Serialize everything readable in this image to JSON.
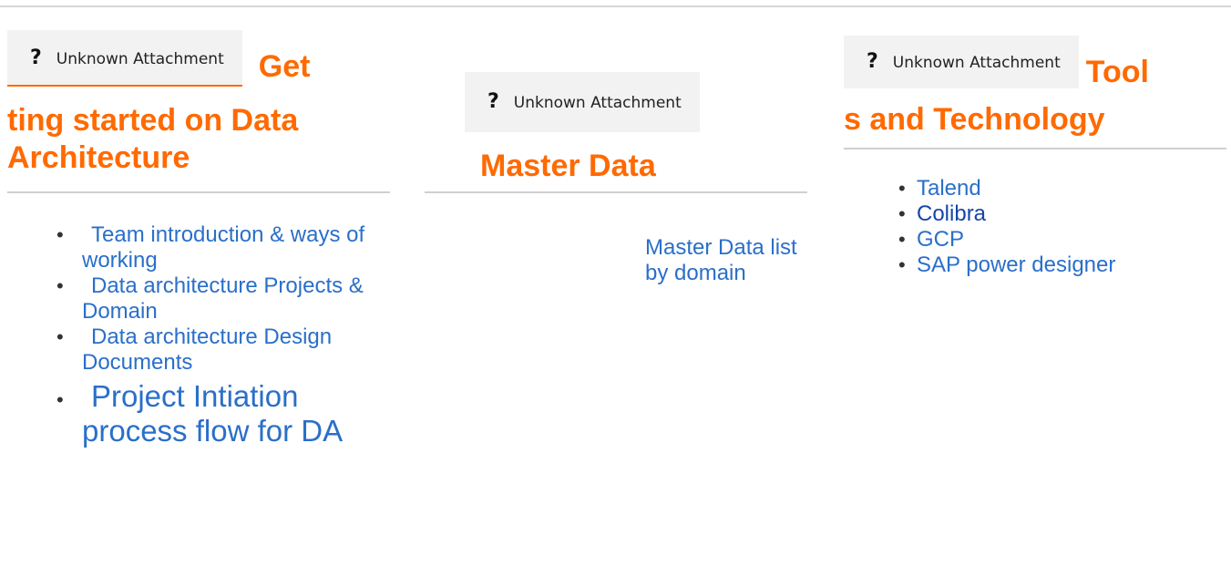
{
  "attachment_label": "Unknown Attachment",
  "colors": {
    "heading": "#ff6a00",
    "link": "#2a6fc9",
    "rule": "#d0d0d0"
  },
  "sections": [
    {
      "heading_suffix": "Get",
      "heading_continuation": "ting started on Data Architecture",
      "links": [
        "Team introduction & ways of working",
        "Data architecture Projects & Domain",
        "Data architecture Design Documents",
        "Project Intiation process flow for DA"
      ]
    },
    {
      "heading": "Master Data",
      "links": [
        "Master Data list by domain"
      ]
    },
    {
      "heading_suffix": "Tool",
      "heading_continuation": "s and Technology",
      "links": [
        "Talend",
        "Colibra",
        "GCP",
        "SAP power designer"
      ]
    }
  ]
}
